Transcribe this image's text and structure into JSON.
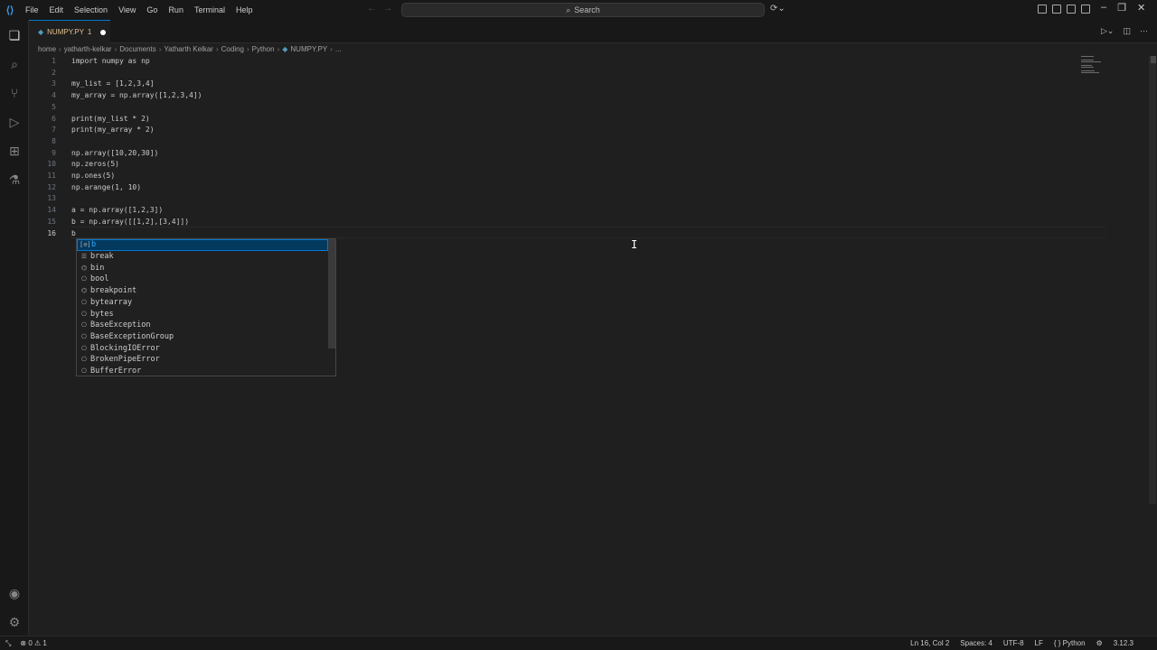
{
  "titlebar": {
    "menu": [
      "File",
      "Edit",
      "Selection",
      "View",
      "Go",
      "Run",
      "Terminal",
      "Help"
    ],
    "search_label": "Search"
  },
  "tab": {
    "label": "NUMPY.PY",
    "count": "1"
  },
  "breadcrumb": [
    "home",
    "yatharth-kelkar",
    "Documents",
    "Yatharth Kelkar",
    "Coding",
    "Python",
    "NUMPY.PY",
    "..."
  ],
  "editor": {
    "line_numbers": [
      "1",
      "2",
      "3",
      "4",
      "5",
      "6",
      "7",
      "8",
      "9",
      "10",
      "11",
      "12",
      "13",
      "14",
      "15",
      "16"
    ],
    "lines": [
      "import numpy as np",
      "",
      "my_list = [1,2,3,4]",
      "my_array = np.array([1,2,3,4])",
      "",
      "print(my_list * 2)",
      "print(my_array * 2)",
      "",
      "np.array([10,20,30])",
      "np.zeros(5)",
      "np.ones(5)",
      "np.arange(1, 10)",
      "",
      "a = np.array([1,2,3])",
      "b = np.array([[1,2],[3,4]])",
      "b"
    ]
  },
  "suggestions": [
    {
      "icon": "variable-icon",
      "glyph": "[⊘]",
      "label": "b"
    },
    {
      "icon": "keyword-icon",
      "glyph": "☰",
      "label": "break"
    },
    {
      "icon": "function-icon",
      "glyph": "⌬",
      "label": "bin"
    },
    {
      "icon": "class-icon",
      "glyph": "⎔",
      "label": "bool"
    },
    {
      "icon": "function-icon",
      "glyph": "⌬",
      "label": "breakpoint"
    },
    {
      "icon": "class-icon",
      "glyph": "⎔",
      "label": "bytearray"
    },
    {
      "icon": "class-icon",
      "glyph": "⎔",
      "label": "bytes"
    },
    {
      "icon": "class-icon",
      "glyph": "⎔",
      "label": "BaseException"
    },
    {
      "icon": "class-icon",
      "glyph": "⎔",
      "label": "BaseExceptionGroup"
    },
    {
      "icon": "class-icon",
      "glyph": "⎔",
      "label": "BlockingIOError"
    },
    {
      "icon": "class-icon",
      "glyph": "⎔",
      "label": "BrokenPipeError"
    },
    {
      "icon": "class-icon",
      "glyph": "⎔",
      "label": "BufferError"
    }
  ],
  "statusbar": {
    "problems": "⊗ 0 ⚠ 1",
    "position": "Ln 16, Col 2",
    "spaces": "Spaces: 4",
    "encoding": "UTF-8",
    "eol": "LF",
    "language": "{ } Python",
    "version": "3.12.3"
  },
  "colors": {
    "accent": "#0078d4",
    "keyword": "#c586c0",
    "function": "#dcdcaa",
    "variable": "#9cdcfe",
    "number": "#b5cea8",
    "module": "#4ec9b0"
  }
}
